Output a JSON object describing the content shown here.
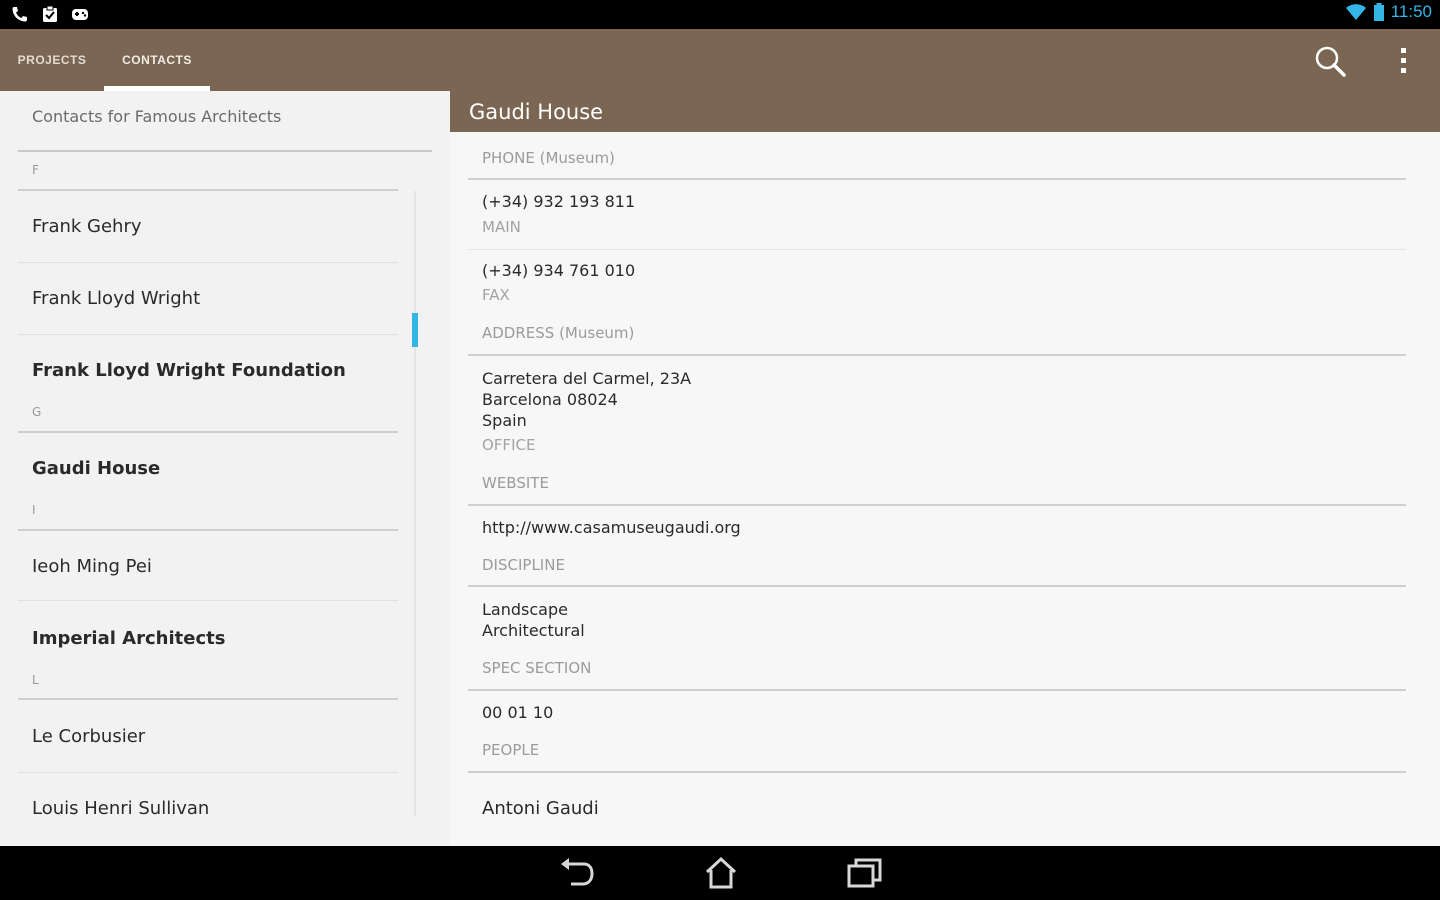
{
  "status_bar": {
    "time": "11:50",
    "left_icons": [
      "phone-icon",
      "clipboard-icon",
      "game-controller-icon"
    ],
    "right_icons": [
      "wifi-icon",
      "battery-icon"
    ],
    "accent": "#33b5e5"
  },
  "action_bar": {
    "color": "#7a6652",
    "tabs": [
      {
        "label": "PROJECTS",
        "selected": false
      },
      {
        "label": "CONTACTS",
        "selected": true
      }
    ],
    "icons": [
      "search-icon",
      "overflow-menu-icon"
    ]
  },
  "contact_list": {
    "header": "Contacts for Famous Architects",
    "sections": [
      {
        "letter": "F",
        "items": [
          {
            "name": "Frank Gehry",
            "bold": false
          },
          {
            "name": "Frank Lloyd Wright",
            "bold": false
          },
          {
            "name": "Frank Lloyd Wright Foundation",
            "bold": true
          }
        ]
      },
      {
        "letter": "G",
        "items": [
          {
            "name": "Gaudi House",
            "bold": true
          }
        ]
      },
      {
        "letter": "I",
        "items": [
          {
            "name": "Ieoh Ming Pei",
            "bold": false
          },
          {
            "name": "Imperial Architects",
            "bold": true
          }
        ]
      },
      {
        "letter": "L",
        "items": [
          {
            "name": "Le Corbusier",
            "bold": false
          },
          {
            "name": "Louis Henri Sullivan",
            "bold": false
          }
        ]
      }
    ]
  },
  "detail": {
    "title": "Gaudi House",
    "phone": {
      "label": "PHONE (Museum)",
      "entries": [
        {
          "number": "(+34) 932 193 811",
          "type": "MAIN"
        },
        {
          "number": "(+34) 934 761 010",
          "type": "FAX"
        }
      ]
    },
    "address": {
      "label": "ADDRESS (Museum)",
      "lines": [
        "Carretera del Carmel, 23A",
        "Barcelona 08024",
        "Spain"
      ],
      "type": "OFFICE"
    },
    "website": {
      "label": "WEBSITE",
      "value": "http://www.casamuseugaudi.org"
    },
    "discipline": {
      "label": "DISCIPLINE",
      "lines": [
        "Landscape",
        "Architectural"
      ]
    },
    "spec_section": {
      "label": "SPEC SECTION",
      "value": "00 01 10"
    },
    "people": {
      "label": "PEOPLE",
      "value": "Antoni Gaudi"
    }
  },
  "nav_bar": {
    "icons": [
      "back-icon",
      "home-icon",
      "recent-apps-icon"
    ]
  }
}
